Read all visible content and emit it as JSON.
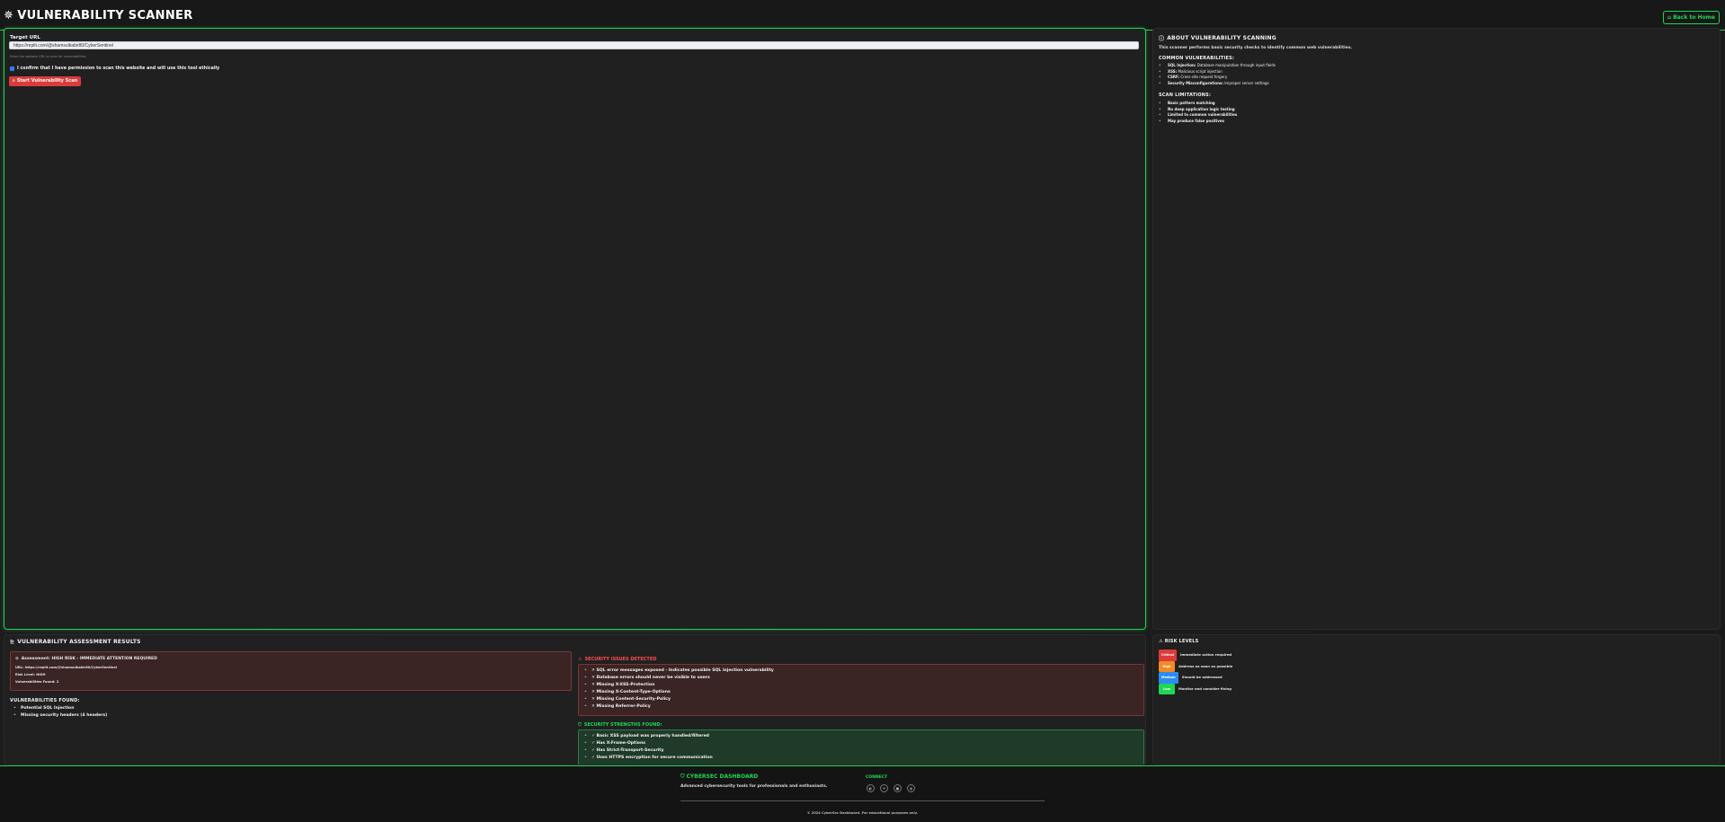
{
  "header": {
    "title": "VULNERABILITY SCANNER",
    "home_button": "Back to Home"
  },
  "scanner": {
    "target_label": "Target URL",
    "url_value": "https://replit.com/@shamsulkabir80/CyberSentinel",
    "hint": "Enter the website URL to scan for vulnerabilities",
    "consent_text": "I confirm that I have permission to scan this website and will use this tool ethically",
    "scan_button": "Start Vulnerability Scan"
  },
  "about": {
    "title": "ABOUT VULNERABILITY SCANNING",
    "intro": "This scanner performs basic security checks to identify common web vulnerabilities.",
    "common_title": "COMMON VULNERABILITIES:",
    "common": [
      {
        "name": "SQL Injection:",
        "desc": " Database manipulation through input fields"
      },
      {
        "name": "XSS:",
        "desc": " Malicious script injection"
      },
      {
        "name": "CSRF:",
        "desc": " Cross-site request forgery"
      },
      {
        "name": "Security Misconfigurations:",
        "desc": " Improper server settings"
      }
    ],
    "limits_title": "SCAN LIMITATIONS:",
    "limits": [
      "Basic pattern matching",
      "No deep application logic testing",
      "Limited to common vulnerabilities",
      "May produce false positives"
    ]
  },
  "results": {
    "title": "VULNERABILITY ASSESSMENT RESULTS",
    "assessment": "Assessment: HIGH RISK - IMMEDIATE ATTENTION REQUIRED",
    "url_line": "URL: https://replit.com/@shamsulkabir80/CyberSentinel",
    "risk_level": "Risk Level: HIGH",
    "vuln_count": "Vulnerabilities Found: 2",
    "found_title": "VULNERABILITIES FOUND:",
    "found": [
      "Potential SQL Injection",
      "Missing security headers (4 headers)"
    ],
    "issues_title": "SECURITY ISSUES DETECTED",
    "issues": [
      "SQL error messages exposed - Indicates possible SQL injection vulnerability",
      "Database errors should never be visible to users",
      "Missing X-XSS-Protection",
      "Missing X-Content-Type-Options",
      "Missing Content-Security-Policy",
      "Missing Referrer-Policy"
    ],
    "positive_title": "SECURITY STRENGTHS FOUND:",
    "positives": [
      "Basic XSS payload was properly handled/filtered",
      "Has X-Frame-Options",
      "Has Strict-Transport-Security",
      "Uses HTTPS encryption for secure communication"
    ]
  },
  "risk_levels": {
    "title": "RISK LEVELS",
    "items": [
      {
        "badge": "Critical",
        "text": "Immediate action required",
        "color": "#dc3b3b"
      },
      {
        "badge": "High",
        "text": "Address as soon as possible",
        "color": "#f08a24"
      },
      {
        "badge": "Medium",
        "text": "Should be addressed",
        "color": "#2d8cf0"
      },
      {
        "badge": "Low",
        "text": "Monitor and consider fixing",
        "color": "#1fd655"
      }
    ]
  },
  "footer": {
    "brand": "CYBERSEC DASHBOARD",
    "tagline": "Advanced cybersecurity tools for professionals and enthusiasts.",
    "connect": "CONNECT",
    "copyright": "© 2024 CyberSec Dashboard. For educational purposes only."
  },
  "colors": {
    "accent": "#1fd655",
    "danger": "#dc3b3b"
  }
}
